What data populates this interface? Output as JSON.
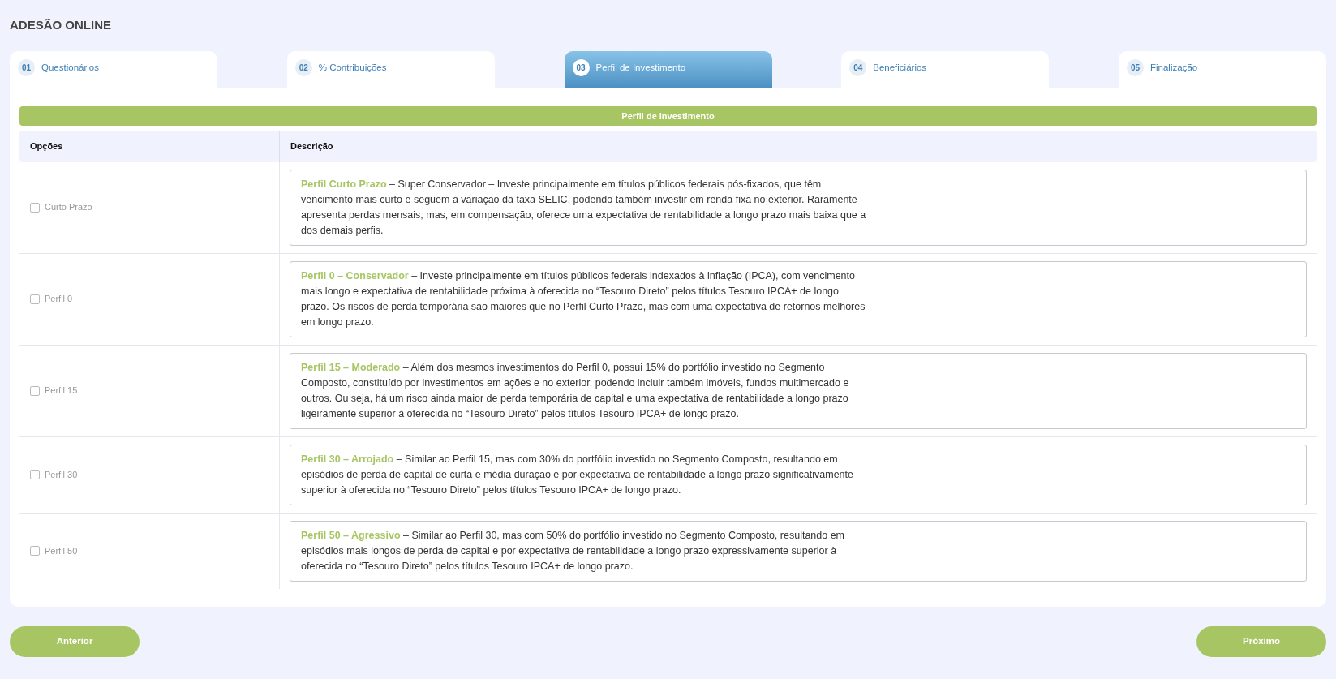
{
  "page_title": "ADESÃO ONLINE",
  "tabs": [
    {
      "number": "01",
      "label": "Questionários",
      "selected": false
    },
    {
      "number": "02",
      "label": "% Contribuições",
      "selected": false
    },
    {
      "number": "03",
      "label": "Perfil de Investimento",
      "selected": true
    },
    {
      "number": "04",
      "label": "Beneficiários",
      "selected": false
    },
    {
      "number": "05",
      "label": "Finalização",
      "selected": false
    }
  ],
  "section_title": "Perfil de Investimento",
  "table": {
    "columns": [
      "Opções",
      "Descrição"
    ],
    "rows": [
      {
        "option": "Curto Prazo",
        "checked": false,
        "title": "Perfil Curto Prazo",
        "text": "– Super Conservador – Investe principalmente em títulos públicos federais pós-fixados, que têm vencimento mais curto e seguem a variação da taxa SELIC, podendo também investir em renda fixa no exterior. Raramente apresenta perdas mensais, mas, em compensação, oferece uma expectativa de rentabilidade a longo prazo mais baixa que a dos demais perfis."
      },
      {
        "option": "Perfil 0",
        "checked": false,
        "title": "Perfil 0 – Conservador",
        "text": "– Investe principalmente em títulos públicos federais indexados à inflação (IPCA), com vencimento mais longo e expectativa de rentabilidade próxima à oferecida no “Tesouro Direto” pelos títulos Tesouro IPCA+ de longo prazo. Os riscos de perda temporária são maiores que no Perfil Curto Prazo, mas com uma expectativa de retornos melhores em longo prazo."
      },
      {
        "option": "Perfil 15",
        "checked": false,
        "title": "Perfil 15 – Moderado",
        "text": "– Além dos mesmos investimentos do Perfil 0, possui 15% do portfólio investido no Segmento Composto, constituído por investimentos em ações e no exterior, podendo incluir também imóveis, fundos multimercado e outros. Ou seja, há um risco ainda maior de perda temporária de capital e uma expectativa de rentabilidade a longo prazo ligeiramente superior à oferecida no “Tesouro Direto” pelos títulos Tesouro IPCA+ de longo prazo."
      },
      {
        "option": "Perfil 30",
        "checked": false,
        "title": "Perfil 30 – Arrojado",
        "text": "– Similar ao Perfil 15, mas com 30% do portfólio investido no Segmento Composto, resultando em episódios de perda de capital de curta e média duração e por expectativa de rentabilidade a longo prazo significativamente superior à oferecida no “Tesouro Direto” pelos títulos Tesouro IPCA+ de longo prazo."
      },
      {
        "option": "Perfil 50",
        "checked": false,
        "title": "Perfil 50 – Agressivo",
        "text": "– Similar ao Perfil 30, mas com 50% do portfólio investido no Segmento Composto, resultando em episódios mais longos de perda de capital e por expectativa de rentabilidade a longo prazo expressivamente superior à oferecida no “Tesouro Direto” pelos títulos Tesouro IPCA+ de longo prazo."
      }
    ]
  },
  "buttons": {
    "previous": "Anterior",
    "next": "Próximo"
  }
}
